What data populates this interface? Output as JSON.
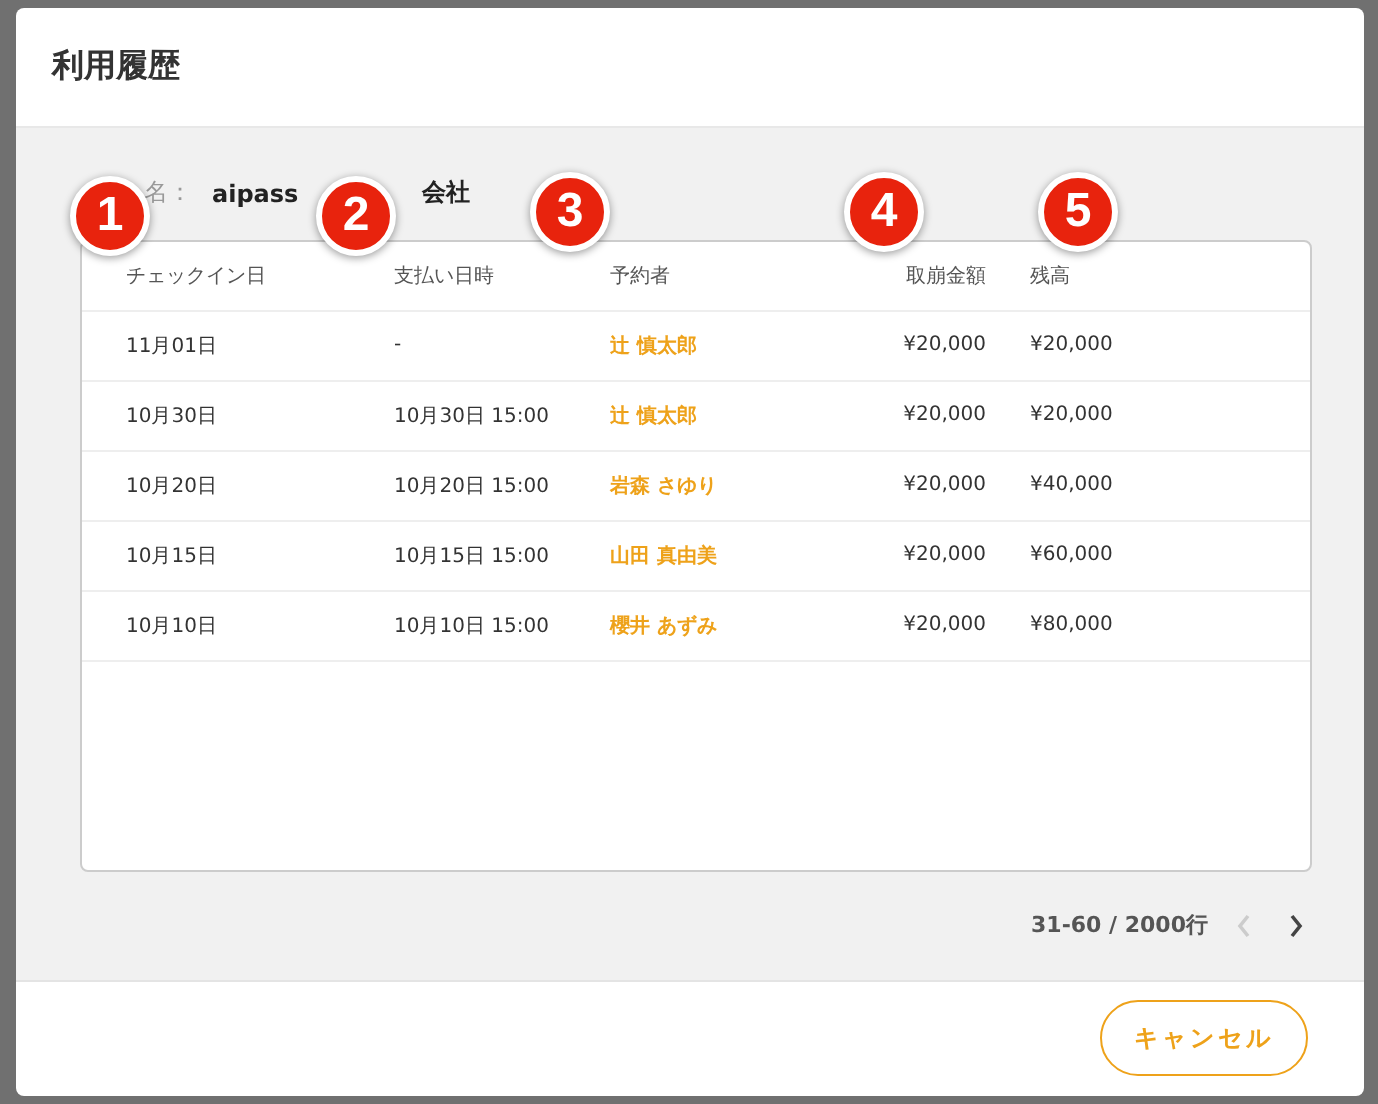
{
  "dialog": {
    "title": "利用履歴"
  },
  "company": {
    "label": "名：",
    "value_parts": [
      "aipass",
      "会社"
    ]
  },
  "markers": [
    "1",
    "2",
    "3",
    "4",
    "5"
  ],
  "table": {
    "columns": [
      "チェックイン日",
      "支払い日時",
      "予約者",
      "取崩金額",
      "残高"
    ],
    "rows": [
      {
        "checkin": "11月01日",
        "paid_at": "-",
        "booker": "辻 慎太郎",
        "amount": "¥20,000",
        "balance": "¥20,000"
      },
      {
        "checkin": "10月30日",
        "paid_at": "10月30日 15:00",
        "booker": "辻 慎太郎",
        "amount": "¥20,000",
        "balance": "¥20,000"
      },
      {
        "checkin": "10月20日",
        "paid_at": "10月20日 15:00",
        "booker": "岩森 さゆり",
        "amount": "¥20,000",
        "balance": "¥40,000"
      },
      {
        "checkin": "10月15日",
        "paid_at": "10月15日 15:00",
        "booker": "山田 真由美",
        "amount": "¥20,000",
        "balance": "¥60,000"
      },
      {
        "checkin": "10月10日",
        "paid_at": "10月10日 15:00",
        "booker": "櫻井 あずみ",
        "amount": "¥20,000",
        "balance": "¥80,000"
      }
    ]
  },
  "pagination": {
    "range": "31-60 / 2000行",
    "prev": {
      "disabled": true
    },
    "next": {
      "disabled": false
    }
  },
  "buttons": {
    "cancel": "キャンセル"
  }
}
